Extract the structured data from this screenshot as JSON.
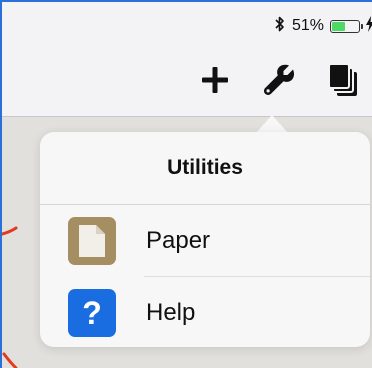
{
  "status_bar": {
    "battery_text": "51%",
    "battery_level": 0.51,
    "bluetooth_icon": "bluetooth-icon",
    "charging_icon": "charging-bolt-icon"
  },
  "toolbar": {
    "add_icon": "plus-icon",
    "utilities_icon": "wrench-icon",
    "documents_icon": "documents-stack-icon"
  },
  "popover": {
    "title": "Utilities",
    "items": [
      {
        "label": "Paper",
        "icon": "paper-icon",
        "icon_bg": "#a58f62"
      },
      {
        "label": "Help",
        "icon": "help-icon",
        "icon_glyph": "?",
        "icon_bg": "#1a6de0"
      }
    ]
  },
  "colors": {
    "accent_blue": "#2b6fd8",
    "annotation_red": "#e23a1e",
    "battery_green": "#4cd964"
  }
}
